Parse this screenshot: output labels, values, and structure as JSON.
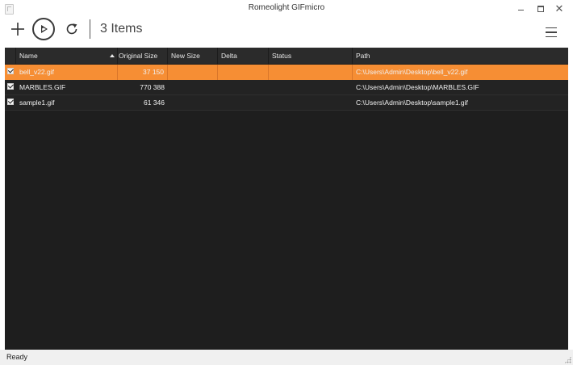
{
  "window": {
    "title": "Romeolight GIFmicro",
    "controls": [
      "minimize-icon",
      "maximize-icon",
      "close-icon"
    ]
  },
  "toolbar": {
    "add_icon": "plus-icon",
    "run_icon": "play-icon",
    "refresh_icon": "refresh-icon",
    "item_count": "3 Items",
    "menu_icon": "hamburger-menu-icon"
  },
  "table": {
    "columns": {
      "name": "Name",
      "original_size": "Original Size",
      "new_size": "New Size",
      "delta": "Delta",
      "status": "Status",
      "path": "Path"
    },
    "sorted_column": "original_size",
    "sort_direction": "ascending",
    "rows": [
      {
        "checked": true,
        "name": "bell_v22.gif",
        "original_size": "37 150",
        "new_size": "",
        "delta": "",
        "status": "",
        "path": "C:\\Users\\Admin\\Desktop\\bell_v22.gif",
        "selected": true
      },
      {
        "checked": true,
        "name": "MARBLES.GIF",
        "original_size": "770 388",
        "new_size": "",
        "delta": "",
        "status": "",
        "path": "C:\\Users\\Admin\\Desktop\\MARBLES.GIF",
        "selected": false
      },
      {
        "checked": true,
        "name": "sample1.gif",
        "original_size": "61 346",
        "new_size": "",
        "delta": "",
        "status": "",
        "path": "C:\\Users\\Admin\\Desktop\\sample1.gif",
        "selected": false
      }
    ]
  },
  "statusbar": {
    "text": "Ready"
  },
  "colors": {
    "selection": "#f68e34",
    "grid_background": "#1e1e1e",
    "header_background": "#2b2b2b"
  }
}
